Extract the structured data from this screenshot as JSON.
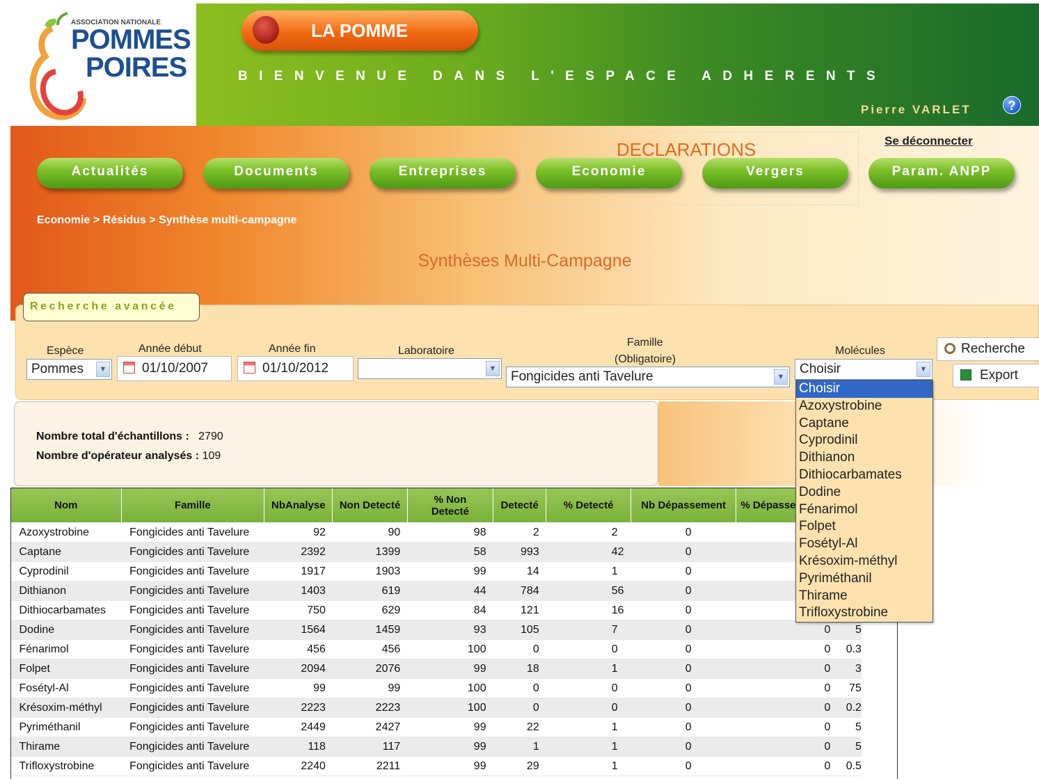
{
  "logo": {
    "small": "ASSOCIATION NATIONALE",
    "line1": "POMMES",
    "line2": "POIRES"
  },
  "header": {
    "app_title": "LA POMME",
    "welcome": "BIENVENUE DANS L'ESPACE ADHERENTS",
    "user": "Pierre VARLET",
    "help_icon": "?"
  },
  "nav": {
    "declarations_label": "DECLARATIONS",
    "logout": "Se déconnecter",
    "items": [
      "Actualités",
      "Documents",
      "Entreprises",
      "Economie",
      "Vergers",
      "Param. ANPP"
    ]
  },
  "breadcrumb": "Economie > Résidus > Synthèse multi-campagne",
  "page_title": "Synthèses Multi-Campagne",
  "search": {
    "tab_label": "Recherche avancée",
    "espece_label": "Espèce",
    "espece_value": "Pommes",
    "annee_debut_label": "Année début",
    "annee_debut_value": "01/10/2007",
    "annee_fin_label": "Année fin",
    "annee_fin_value": "01/10/2012",
    "laboratoire_label": "Laboratoire",
    "laboratoire_value": "",
    "famille_label_1": "Famille",
    "famille_label_2": "(Obligatoire)",
    "famille_value": "Fongicides anti Tavelure",
    "molecules_label": "Molécules",
    "molecules_value": "Choisir",
    "search_button": "Recherche",
    "export_button": "Export",
    "molecules_options": [
      "Choisir",
      "Azoxystrobine",
      "Captane",
      "Cyprodinil",
      "Dithianon",
      "Dithiocarbamates",
      "Dodine",
      "Fénarimol",
      "Folpet",
      "Fosétyl-Al",
      "Krésoxim-méthyl",
      "Pyriméthanil",
      "Thirame",
      "Trifloxystrobine"
    ]
  },
  "stats": {
    "total_label": "Nombre total d'échantillons :",
    "total_value": "2790",
    "operateurs_label": "Nombre d'opérateur analysés :",
    "operateurs_value": "109"
  },
  "table": {
    "headers": [
      "Nom",
      "Famille",
      "NbAnalyse",
      "Non Detecté",
      "% Non Detecté",
      "Detecté",
      "% Detecté",
      "Nb Dépassement",
      "% Dépasse",
      "",
      ""
    ],
    "rows": [
      [
        "Azoxystrobine",
        "Fongicides anti Tavelure",
        "92",
        "90",
        "98",
        "2",
        "2",
        "0",
        "",
        ""
      ],
      [
        "Captane",
        "Fongicides anti Tavelure",
        "2392",
        "1399",
        "58",
        "993",
        "42",
        "0",
        "",
        ""
      ],
      [
        "Cyprodinil",
        "Fongicides anti Tavelure",
        "1917",
        "1903",
        "99",
        "14",
        "1",
        "0",
        "",
        ""
      ],
      [
        "Dithianon",
        "Fongicides anti Tavelure",
        "1403",
        "619",
        "44",
        "784",
        "56",
        "0",
        "",
        ""
      ],
      [
        "Dithiocarbamates",
        "Fongicides anti Tavelure",
        "750",
        "629",
        "84",
        "121",
        "16",
        "0",
        "",
        ""
      ],
      [
        "Dodine",
        "Fongicides anti Tavelure",
        "1564",
        "1459",
        "93",
        "105",
        "7",
        "0",
        "0",
        "5"
      ],
      [
        "Fénarimol",
        "Fongicides anti Tavelure",
        "456",
        "456",
        "100",
        "0",
        "0",
        "0",
        "0",
        "0.3"
      ],
      [
        "Folpet",
        "Fongicides anti Tavelure",
        "2094",
        "2076",
        "99",
        "18",
        "1",
        "0",
        "0",
        "3"
      ],
      [
        "Fosétyl-Al",
        "Fongicides anti Tavelure",
        "99",
        "99",
        "100",
        "0",
        "0",
        "0",
        "0",
        "75"
      ],
      [
        "Krésoxim-méthyl",
        "Fongicides anti Tavelure",
        "2223",
        "2223",
        "100",
        "0",
        "0",
        "0",
        "0",
        "0.2"
      ],
      [
        "Pyriméthanil",
        "Fongicides anti Tavelure",
        "2449",
        "2427",
        "99",
        "22",
        "1",
        "0",
        "0",
        "5"
      ],
      [
        "Thirame",
        "Fongicides anti Tavelure",
        "118",
        "117",
        "99",
        "1",
        "1",
        "0",
        "0",
        "5"
      ],
      [
        "Trifloxystrobine",
        "Fongicides anti Tavelure",
        "2240",
        "2211",
        "99",
        "29",
        "1",
        "0",
        "0",
        "0.5"
      ]
    ]
  }
}
